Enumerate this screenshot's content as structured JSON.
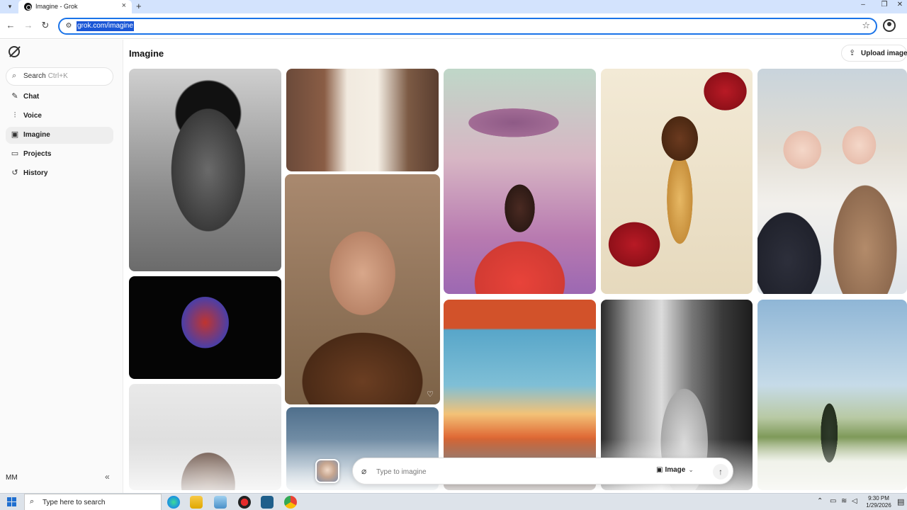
{
  "browser": {
    "tab_title": "Imagine - Grok",
    "url": "grok.com/imagine",
    "new_tab": "+",
    "tab_close": "×",
    "window_controls": [
      "–",
      "❐",
      "✕"
    ]
  },
  "sidebar": {
    "search_label": "Search",
    "search_shortcut": "Ctrl+K",
    "items": [
      {
        "label": "Chat",
        "icon": "chat-icon",
        "glyph": "✎"
      },
      {
        "label": "Voice",
        "icon": "voice-icon",
        "glyph": "⫶"
      },
      {
        "label": "Imagine",
        "icon": "imagine-icon",
        "glyph": "▣",
        "active": true
      },
      {
        "label": "Projects",
        "icon": "folder-icon",
        "glyph": "▭"
      },
      {
        "label": "History",
        "icon": "history-icon",
        "glyph": "↺"
      }
    ],
    "user_initials": "MM",
    "collapse_glyph": "«"
  },
  "main": {
    "title": "Imagine",
    "upload_label": "Upload image"
  },
  "composer": {
    "placeholder": "Type to imagine",
    "mode_label": "Image"
  },
  "taskbar": {
    "search_placeholder": "Type here to search",
    "time": "9:30 PM",
    "date": "1/29/2026"
  },
  "colors": {
    "accent": "#1a73e8",
    "url_highlight": "#1a56d6",
    "tab_strip": "#d3e3fd",
    "sidebar_bg": "#fafafa",
    "taskbar_bg": "#dde3ea"
  }
}
